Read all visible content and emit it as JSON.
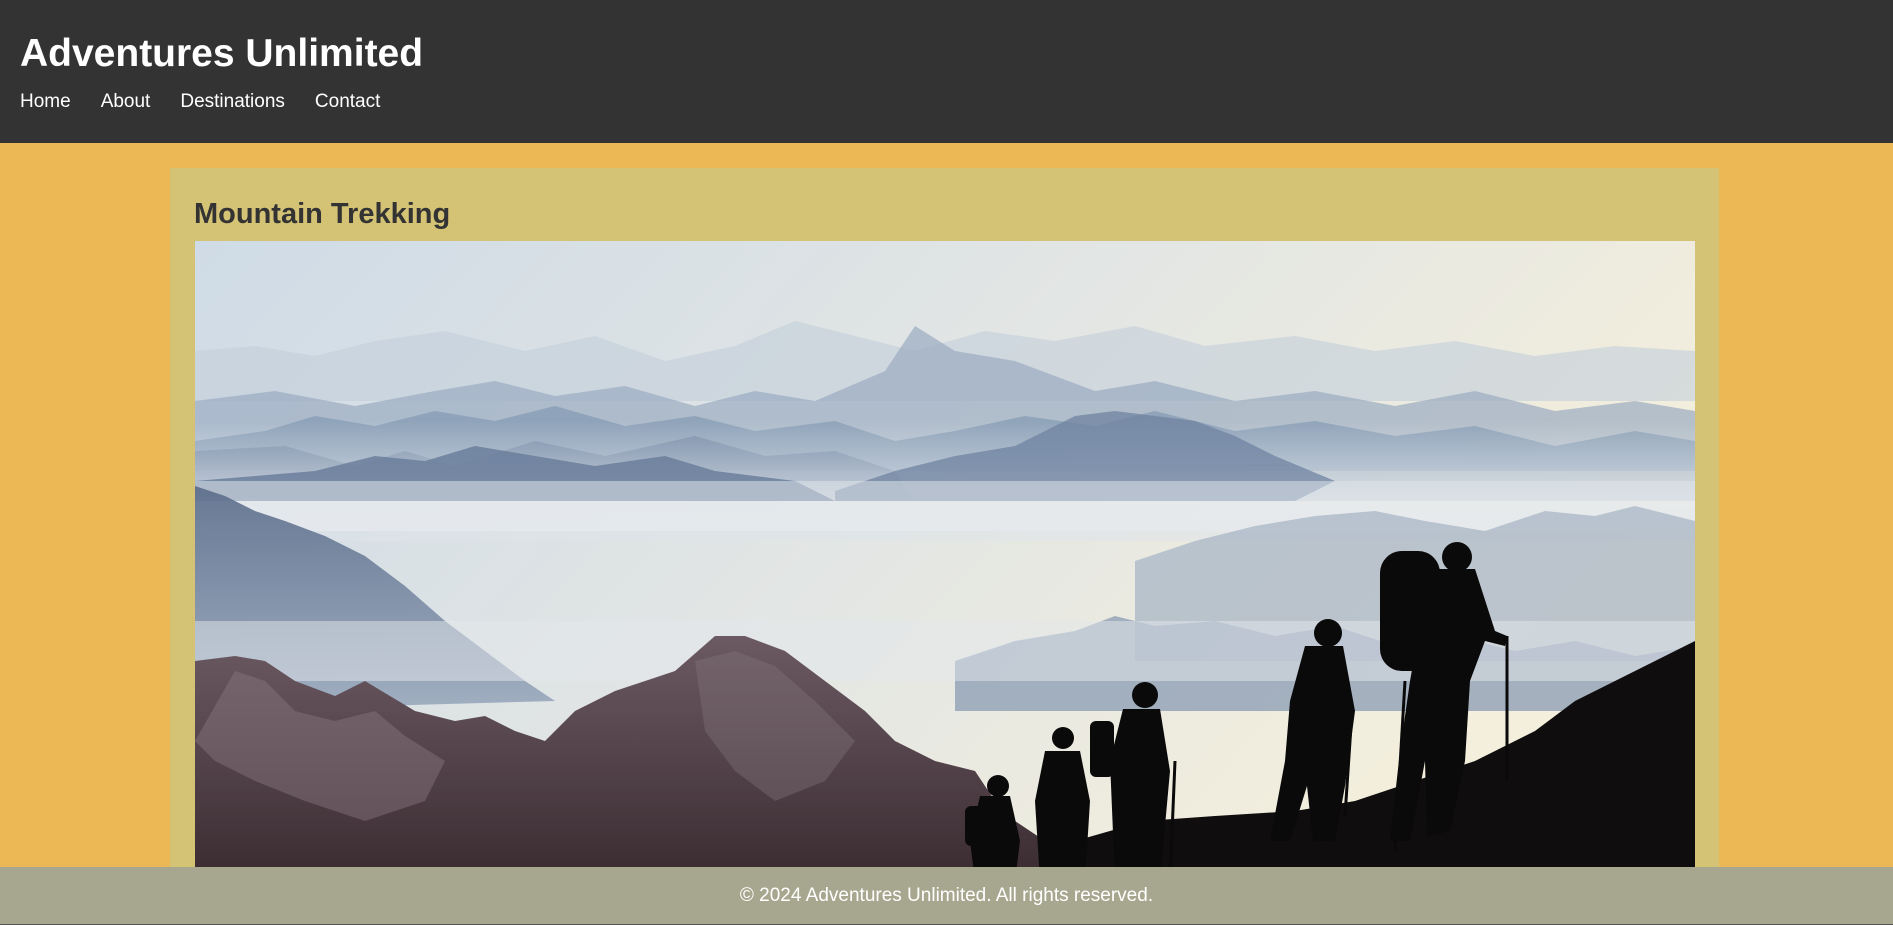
{
  "header": {
    "title": "Adventures Unlimited",
    "nav": [
      "Home",
      "About",
      "Destinations",
      "Contact"
    ]
  },
  "main": {
    "card_title": "Mountain Trekking",
    "image_subject": "hikers-silhouette-on-misty-mountains"
  },
  "footer": {
    "text": "© 2024 Adventures Unlimited. All rights reserved."
  },
  "colors": {
    "header_bg": "#333333",
    "page_bg": "#ebb855",
    "card_bg": "#d4c275",
    "footer_bg": "#a7a78f",
    "text_dark": "#333333",
    "text_light": "#ffffff"
  }
}
